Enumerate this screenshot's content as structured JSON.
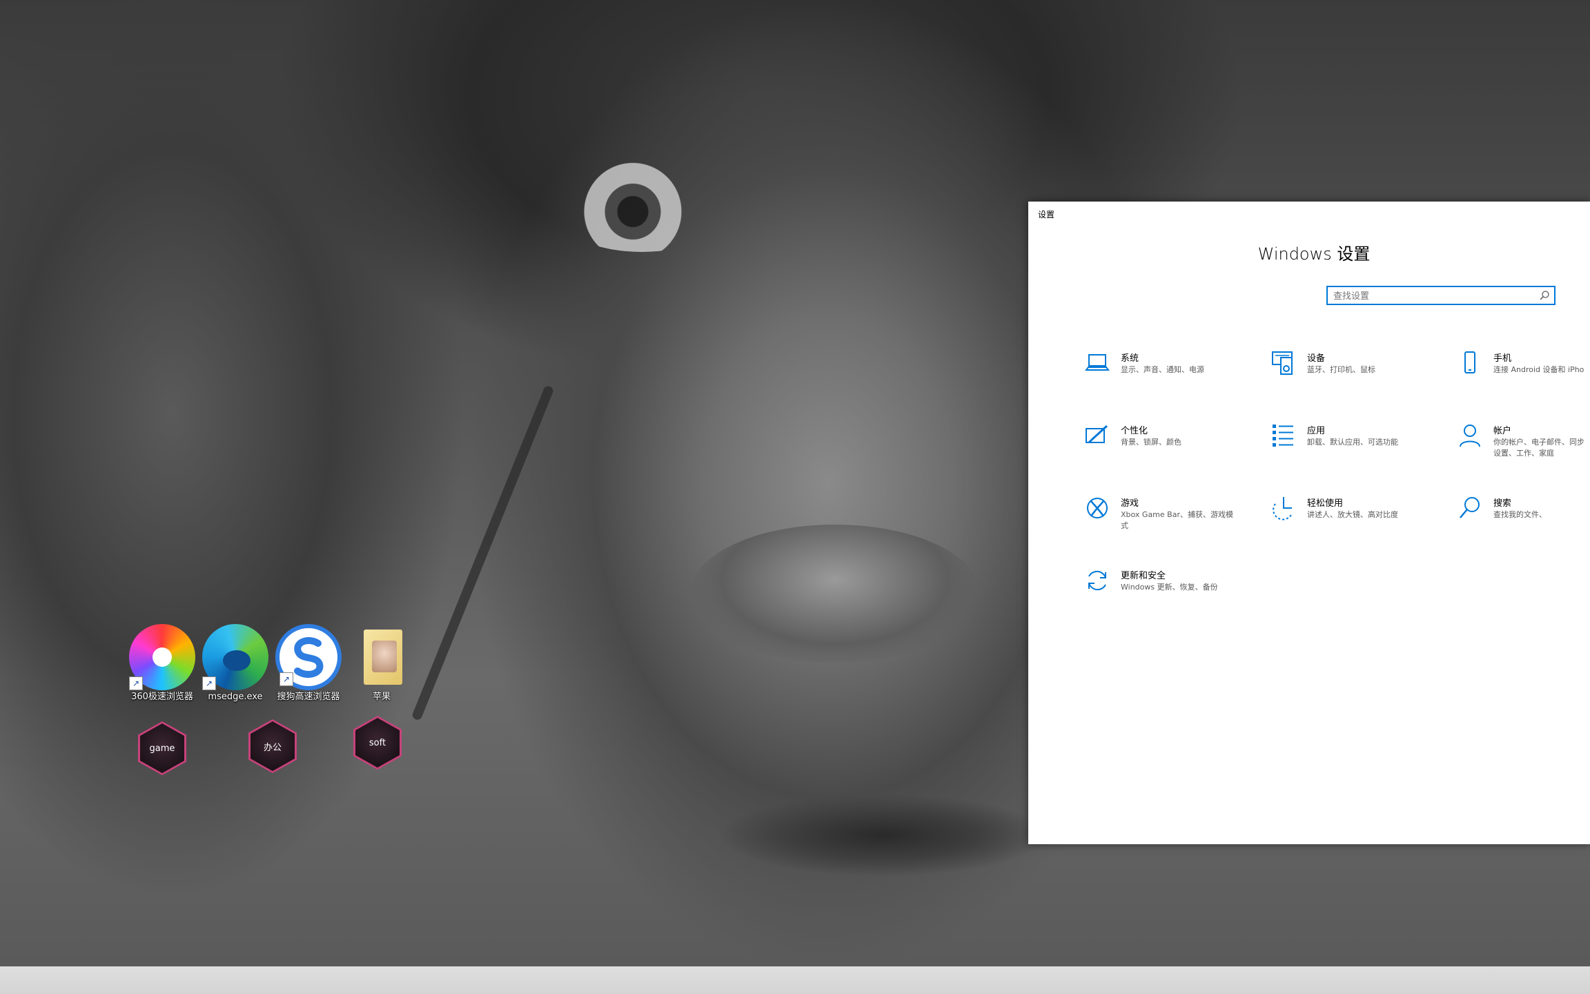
{
  "desktop": {
    "icons": [
      {
        "label": "360极速浏览器"
      },
      {
        "label": "msedge.exe"
      },
      {
        "label": "搜狗高速浏览器"
      },
      {
        "label": "苹果"
      }
    ],
    "fences": [
      {
        "label": "game"
      },
      {
        "label": "办公"
      },
      {
        "label": "soft"
      }
    ]
  },
  "settings": {
    "window_title": "设置",
    "heading": "Windows 设置",
    "search": {
      "placeholder": "查找设置",
      "value": ""
    },
    "accent_color": "#0078d7",
    "tiles": [
      {
        "title": "系统",
        "desc": "显示、声音、通知、电源",
        "icon": "laptop-icon"
      },
      {
        "title": "设备",
        "desc": "蓝牙、打印机、鼠标",
        "icon": "devices-icon"
      },
      {
        "title": "手机",
        "desc": "连接 Android 设备和 iPho",
        "icon": "phone-icon"
      },
      {
        "title": "个性化",
        "desc": "背景、锁屏、颜色",
        "icon": "personalization-icon"
      },
      {
        "title": "应用",
        "desc": "卸载、默认应用、可选功能",
        "icon": "apps-icon"
      },
      {
        "title": "帐户",
        "desc": "你的帐户、电子邮件、同步设置、工作、家庭",
        "icon": "account-icon"
      },
      {
        "title": "游戏",
        "desc": "Xbox Game Bar、捕获、游戏模式",
        "icon": "xbox-icon"
      },
      {
        "title": "轻松使用",
        "desc": "讲述人、放大镜、高对比度",
        "icon": "ease-of-access-icon"
      },
      {
        "title": "搜索",
        "desc": "查找我的文件、",
        "icon": "search-icon"
      },
      {
        "title": "更新和安全",
        "desc": "Windows 更新、恢复、备份",
        "icon": "update-icon"
      }
    ]
  }
}
